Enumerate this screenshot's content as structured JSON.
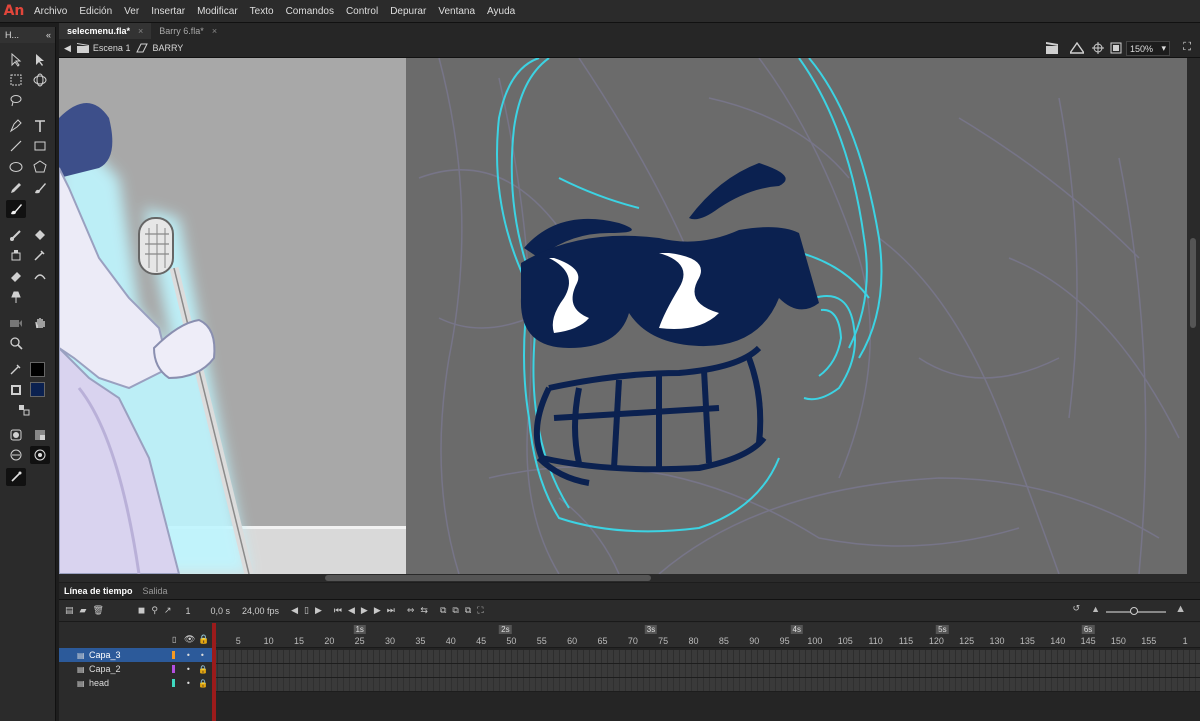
{
  "app": {
    "logo": "An"
  },
  "menu": [
    "Archivo",
    "Edición",
    "Ver",
    "Insertar",
    "Modificar",
    "Texto",
    "Comandos",
    "Control",
    "Depurar",
    "Ventana",
    "Ayuda"
  ],
  "toolbar": {
    "header": "H..."
  },
  "tabs": [
    {
      "label": "selecmenu.fla*",
      "active": true
    },
    {
      "label": "Barry 6.fla*",
      "active": false
    }
  ],
  "editbar": {
    "scene": "Escena 1",
    "symbol": "BARRY",
    "zoom": "150%"
  },
  "colors": {
    "stroke": "#000000",
    "fill": "#0b2150",
    "layer_capa3": "#f59a23",
    "layer_capa2": "#b44fe0",
    "layer_head": "#3fd9c0",
    "accent": "#2c5a9a"
  },
  "timeline": {
    "tabs": [
      "Línea de tiempo",
      "Salida"
    ],
    "current_frame": "1",
    "time": "0,0 s",
    "fps": "24,00 fps",
    "ruler_numbers": [
      "1",
      "5",
      "10",
      "15",
      "20",
      "25",
      "30",
      "35",
      "40",
      "45",
      "50",
      "55",
      "60",
      "65",
      "70",
      "75",
      "80",
      "85",
      "90",
      "95",
      "100",
      "105",
      "110",
      "115",
      "120",
      "125",
      "130",
      "135",
      "140",
      "145",
      "150",
      "155",
      "1"
    ],
    "seconds": [
      "1s",
      "2s",
      "3s",
      "4s",
      "5s",
      "6s"
    ],
    "layers": [
      {
        "name": "Capa_3",
        "selected": true
      },
      {
        "name": "Capa_2",
        "selected": false
      },
      {
        "name": "head",
        "selected": false
      }
    ]
  }
}
